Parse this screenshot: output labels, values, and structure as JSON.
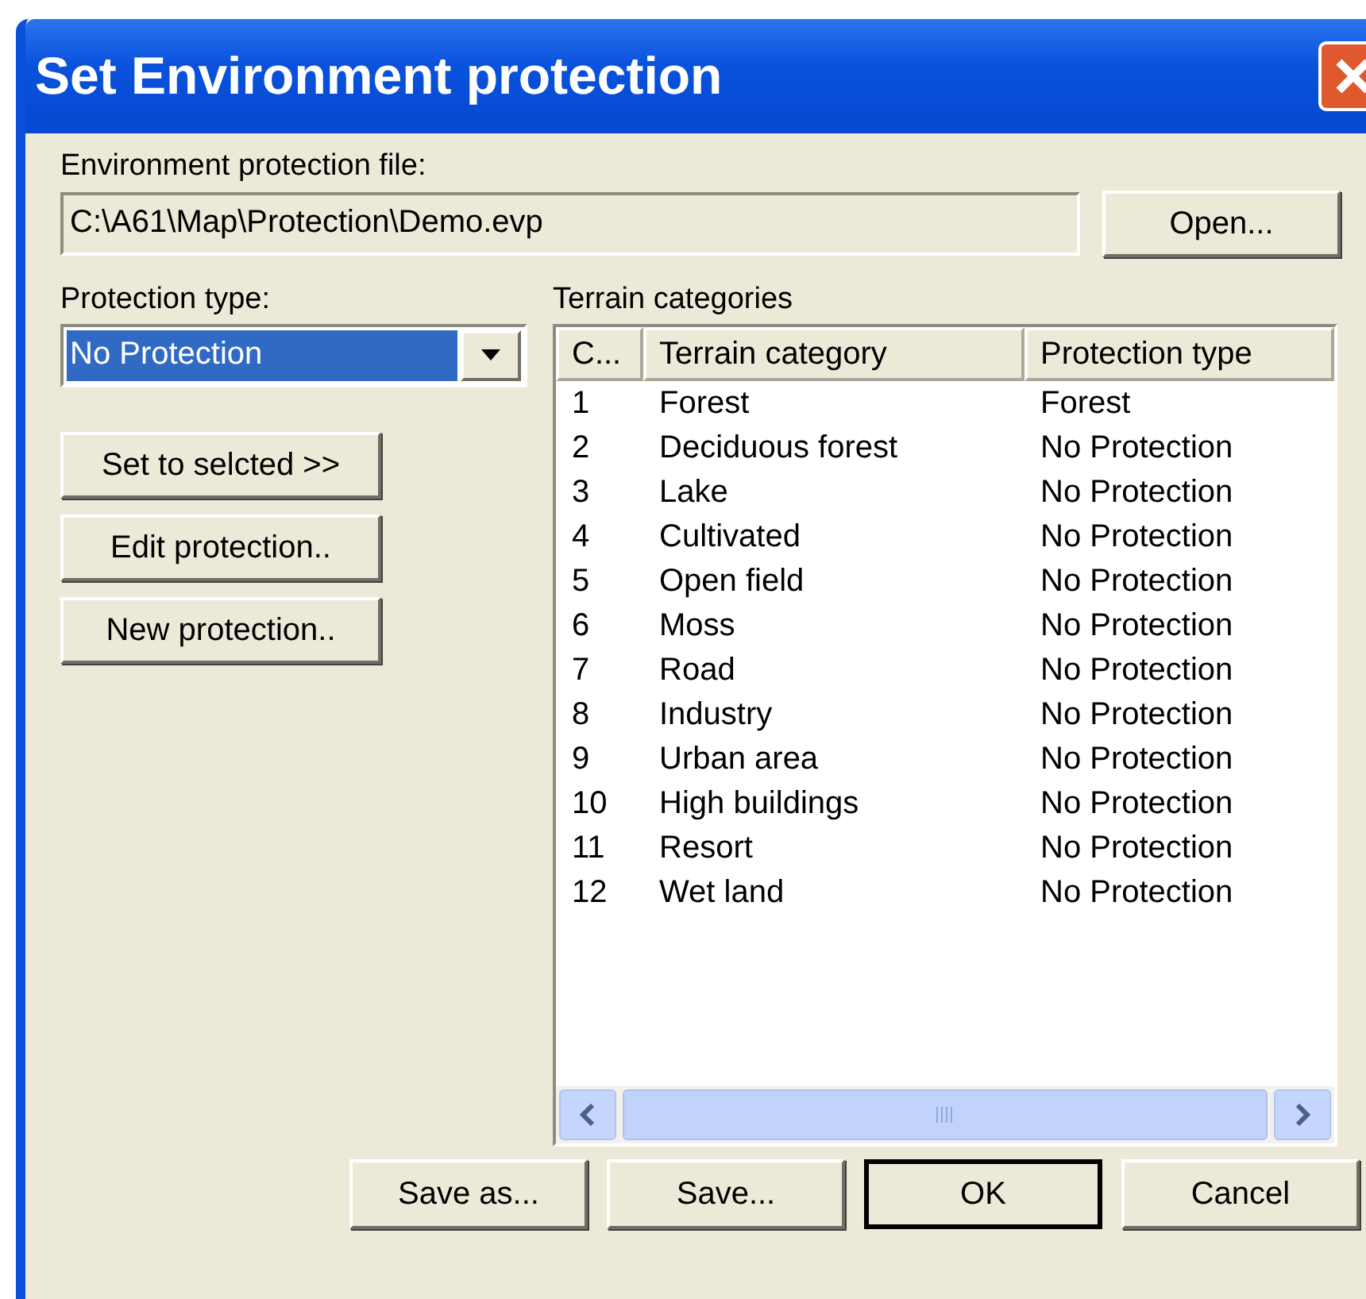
{
  "window": {
    "title": "Set Environment protection"
  },
  "file": {
    "label": "Environment protection file:",
    "value": "C:\\A61\\Map\\Protection\\Demo.evp",
    "button": "Open..."
  },
  "protection": {
    "label": "Protection type:",
    "value": "No Protection",
    "focused": true,
    "buttons": [
      "Set to selcted >>",
      "Edit protection..",
      "New protection.."
    ]
  },
  "terrain": {
    "label": "Terrain categories",
    "columns": [
      "C...",
      "Terrain category",
      "Protection type"
    ],
    "rows": [
      [
        "1",
        "Forest",
        "Forest"
      ],
      [
        "2",
        "Deciduous forest",
        "No Protection"
      ],
      [
        "3",
        "Lake",
        "No Protection"
      ],
      [
        "4",
        "Cultivated",
        "No Protection"
      ],
      [
        "5",
        "Open field",
        "No Protection"
      ],
      [
        "6",
        "Moss",
        "No Protection"
      ],
      [
        "7",
        "Road",
        "No Protection"
      ],
      [
        "8",
        "Industry",
        "No Protection"
      ],
      [
        "9",
        "Urban area",
        "No Protection"
      ],
      [
        "10",
        "High buildings",
        "No Protection"
      ],
      [
        "11",
        "Resort",
        "No Protection"
      ],
      [
        "12",
        "Wet land",
        "No Protection"
      ]
    ]
  },
  "buttons": [
    {
      "label": "Save as...",
      "default": false
    },
    {
      "label": "Save...",
      "default": false
    },
    {
      "label": "OK",
      "default": true
    },
    {
      "label": "Cancel",
      "default": false
    }
  ]
}
